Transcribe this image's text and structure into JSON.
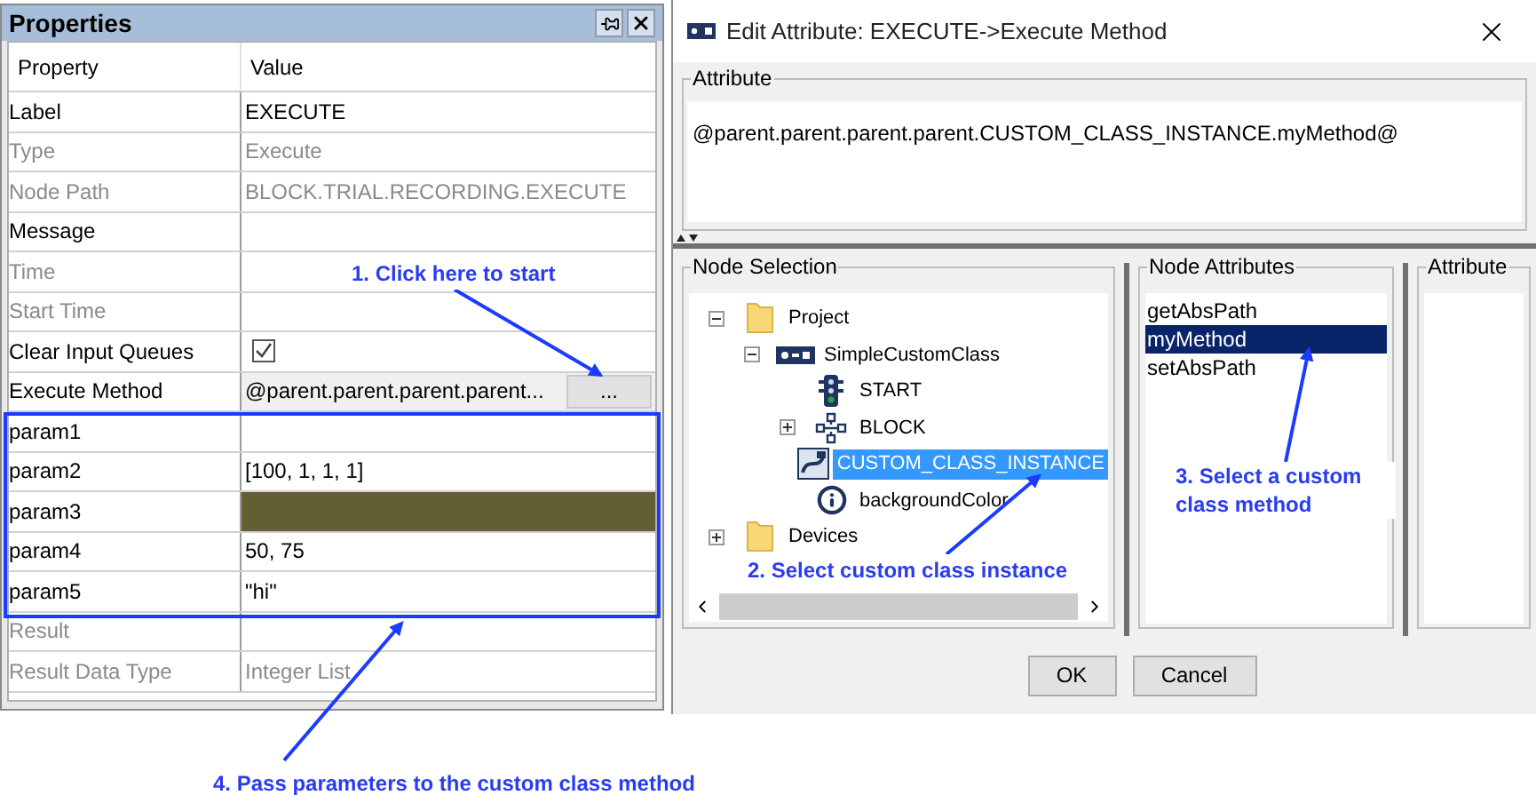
{
  "properties_panel": {
    "title": "Properties",
    "columns": [
      "Property",
      "Value"
    ],
    "rows": [
      {
        "property": "Label",
        "value": "EXECUTE",
        "kind": "text",
        "disabled": false
      },
      {
        "property": "Type",
        "value": "Execute",
        "kind": "text",
        "disabled": true
      },
      {
        "property": "Node Path",
        "value": "BLOCK.TRIAL.RECORDING.EXECUTE",
        "kind": "text",
        "disabled": true
      },
      {
        "property": "Message",
        "kind": "text",
        "disabled": false
      },
      {
        "property": "Time",
        "kind": "text",
        "disabled": true
      },
      {
        "property": "Start Time",
        "kind": "text",
        "disabled": true
      },
      {
        "property": "Clear Input Queues",
        "kind": "checkbox",
        "checked": true,
        "disabled": false
      },
      {
        "property": "Execute Method",
        "value": "@parent.parent.parent.parent...",
        "button": "...",
        "kind": "button",
        "disabled": false
      },
      {
        "property": "param1",
        "kind": "text",
        "disabled": false
      },
      {
        "property": "param2",
        "value": "[100, 1, 1, 1]",
        "kind": "text",
        "disabled": false
      },
      {
        "property": "param3",
        "kind": "color",
        "color": "#645e33",
        "disabled": false
      },
      {
        "property": "param4",
        "value": "50, 75",
        "kind": "text",
        "disabled": false
      },
      {
        "property": "param5",
        "value": "\"hi\"",
        "kind": "text",
        "disabled": false
      },
      {
        "property": "Result",
        "kind": "text",
        "disabled": true
      },
      {
        "property": "Result Data Type",
        "value": "Integer List",
        "kind": "text",
        "disabled": true
      }
    ]
  },
  "dialog": {
    "title": "Edit Attribute: EXECUTE->Execute Method",
    "attribute": {
      "label": "Attribute",
      "value": "@parent.parent.parent.parent.CUSTOM_CLASS_INSTANCE.myMethod@"
    },
    "node_selection": {
      "label": "Node Selection",
      "tree": [
        {
          "label": "Project",
          "kind": "folder",
          "expanded": true,
          "selected": false,
          "children": [
            {
              "label": "SimpleCustomClass",
              "kind": "class",
              "expanded": true,
              "selected": false,
              "children": [
                {
                  "label": "START",
                  "kind": "start",
                  "selected": false
                },
                {
                  "label": "BLOCK",
                  "kind": "block",
                  "expanded": false,
                  "selected": false
                },
                {
                  "label": "CUSTOM_CLASS_INSTANCE",
                  "kind": "instance",
                  "selected": true
                },
                {
                  "label": "backgroundColor",
                  "kind": "info",
                  "selected": false
                }
              ]
            }
          ]
        },
        {
          "label": "Devices",
          "kind": "folder",
          "expanded": false,
          "selected": false
        }
      ]
    },
    "node_attributes": {
      "label": "Node Attributes",
      "items": [
        {
          "label": "getAbsPath",
          "selected": false
        },
        {
          "label": "myMethod",
          "selected": true
        },
        {
          "label": "setAbsPath",
          "selected": false
        }
      ]
    },
    "attribute_panel": {
      "label": "Attribute"
    },
    "buttons": [
      "OK",
      "Cancel"
    ]
  },
  "annotations": [
    "1. Click here to start",
    "2. Select custom class instance",
    "3. Select a custom class method",
    "4. Pass parameters to the custom class method"
  ]
}
